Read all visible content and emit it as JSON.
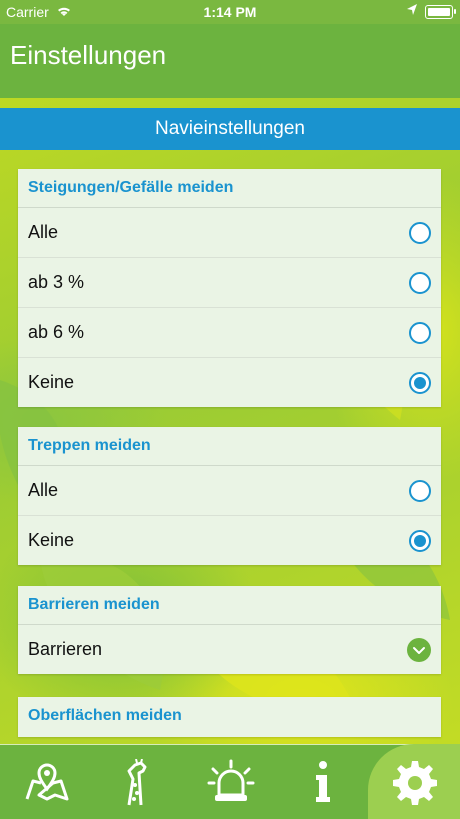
{
  "status_bar": {
    "carrier": "Carrier",
    "time": "1:14 PM"
  },
  "nav": {
    "title": "Einstellungen"
  },
  "section": {
    "title": "Navieinstellungen"
  },
  "groups": [
    {
      "title": "Steigungen/Gefälle meiden",
      "options": [
        {
          "label": "Alle",
          "selected": false
        },
        {
          "label": "ab 3 %",
          "selected": false
        },
        {
          "label": "ab 6 %",
          "selected": false
        },
        {
          "label": "Keine",
          "selected": true
        }
      ]
    },
    {
      "title": "Treppen meiden",
      "options": [
        {
          "label": "Alle",
          "selected": false
        },
        {
          "label": "Keine",
          "selected": true
        }
      ]
    },
    {
      "title": "Barrieren meiden",
      "options": [
        {
          "label": "Barrieren",
          "checked": true
        }
      ]
    },
    {
      "title": "Oberflächen meiden",
      "options": []
    }
  ],
  "tabs": [
    {
      "icon": "map-pin-icon",
      "active": false
    },
    {
      "icon": "giraffe-icon",
      "active": false
    },
    {
      "icon": "alarm-siren-icon",
      "active": false
    },
    {
      "icon": "info-icon",
      "active": false
    },
    {
      "icon": "gear-icon",
      "active": true
    }
  ],
  "colors": {
    "brand_green": "#6cb33f",
    "accent_blue": "#1a93cf",
    "card_bg": "#eaf4e5"
  }
}
